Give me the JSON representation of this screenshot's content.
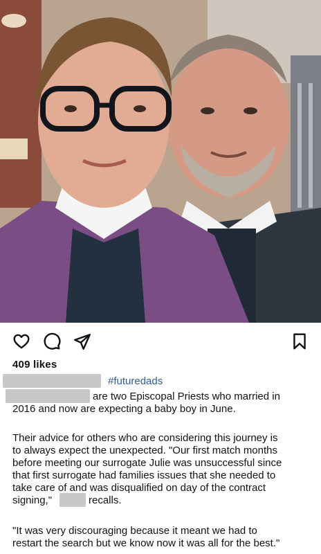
{
  "post": {
    "image_alt": "Selfie of two clergymen wearing clerical collars",
    "likes": "409 likes",
    "hashtag": "#futuredads",
    "caption_line1_tail": "are two Episcopal Priests who married in",
    "caption_line2": "2016 and now are expecting a baby boy in June.",
    "para2": [
      "Their advice for others who are considering this journey is",
      "to always expect the unexpected. \"Our first match months",
      "before meeting our surrogate Julie was unsuccessful since",
      "that first surrogate had families issues that she needed to",
      "take care of and was disqualified on day of the contract"
    ],
    "para2_last_start": "signing,\"",
    "para2_last_end": "recalls.",
    "para3": [
      "\"It was very discouraging because it meant we had to",
      "restart the search but we know now it was all for the best.\""
    ]
  },
  "icons": {
    "like": "heart-icon",
    "comment": "comment-icon",
    "share": "share-icon",
    "save": "bookmark-icon"
  }
}
